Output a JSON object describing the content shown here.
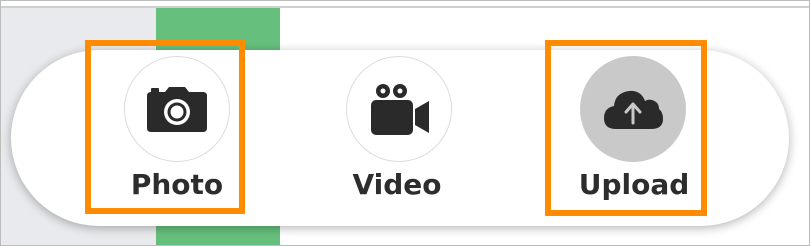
{
  "toolbar": {
    "items": [
      {
        "label": "Photo",
        "icon": "camera-icon",
        "highlighted": true,
        "active": false
      },
      {
        "label": "Video",
        "icon": "video-camera-icon",
        "highlighted": false,
        "active": false
      },
      {
        "label": "Upload",
        "icon": "cloud-upload-icon",
        "highlighted": true,
        "active": true
      }
    ]
  },
  "colors": {
    "highlight": "#ff8c00",
    "accent_green": "#66bf7c",
    "icon": "#2a2a2a",
    "active_circle": "#c9c9c9"
  }
}
